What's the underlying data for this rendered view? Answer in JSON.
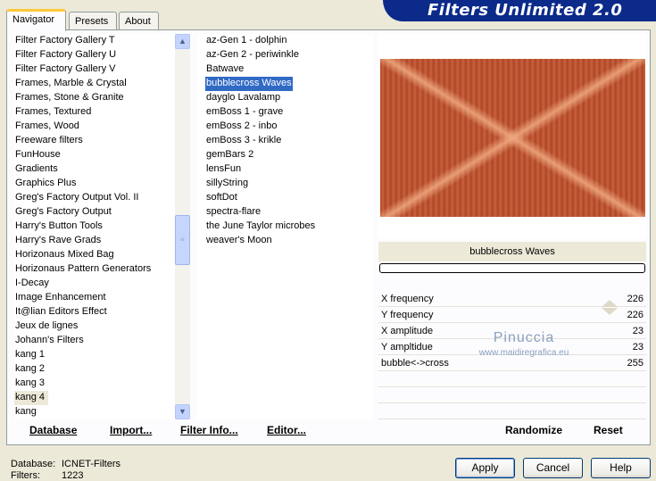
{
  "tabs": [
    "Navigator",
    "Presets",
    "About"
  ],
  "app_title": "Filters Unlimited 2.0",
  "categories": [
    "Filter Factory Gallery T",
    "Filter Factory Gallery U",
    "Filter Factory Gallery V",
    "Frames, Marble & Crystal",
    "Frames, Stone & Granite",
    "Frames, Textured",
    "Frames, Wood",
    "Freeware filters",
    "FunHouse",
    "Gradients",
    "Graphics Plus",
    "Greg's Factory Output Vol. II",
    "Greg's Factory Output",
    "Harry's Button Tools",
    "Harry's Rave Grads",
    "Horizonaus Mixed Bag",
    "Horizonaus Pattern Generators",
    "I-Decay",
    "Image Enhancement",
    "It@lian Editors Effect",
    "Jeux de lignes",
    "Johann's Filters",
    "kang 1",
    "kang 2",
    "kang 3",
    "kang 4",
    "kang"
  ],
  "selected_category": "kang 4",
  "filters": [
    "az-Gen 1  -  dolphin",
    "az-Gen 2  -  periwinkle",
    "Batwave",
    "bubblecross Waves",
    "dayglo Lavalamp",
    "emBoss 1  -  grave",
    "emBoss 2  -  inbo",
    "emBoss 3  -  krikle",
    "gemBars 2",
    "lensFun",
    "sillyString",
    "softDot",
    "spectra-flare",
    "the June Taylor microbes",
    "weaver's Moon"
  ],
  "selected_filter": "bubblecross Waves",
  "preview_filter_name": "bubblecross Waves",
  "sliders": [
    {
      "label": "X frequency",
      "value": "226",
      "level": 0.886
    },
    {
      "label": "Y frequency",
      "value": "226",
      "level": 0.886
    },
    {
      "label": "X amplitude",
      "value": "23",
      "level": 0.09
    },
    {
      "label": "Y ampltidue",
      "value": "23",
      "level": 0.09
    },
    {
      "label": "bubble<->cross",
      "value": "255",
      "level": 1.0
    }
  ],
  "watermark": {
    "name": "Pinuccia",
    "site": "www.maidiregrafica.eu"
  },
  "buttons": {
    "database": "Database",
    "import": "Import...",
    "filter_info": "Filter Info...",
    "editor": "Editor...",
    "randomize": "Randomize",
    "reset": "Reset",
    "apply": "Apply",
    "cancel": "Cancel",
    "help": "Help"
  },
  "footer": {
    "database_label": "Database:",
    "database_value": "ICNET-Filters",
    "filters_label": "Filters:",
    "filters_value": "1223"
  },
  "colors": {
    "selection_blue": "#316ac5",
    "banner_blue": "#0b2a8a",
    "preview_rust": "#b24a2d"
  }
}
